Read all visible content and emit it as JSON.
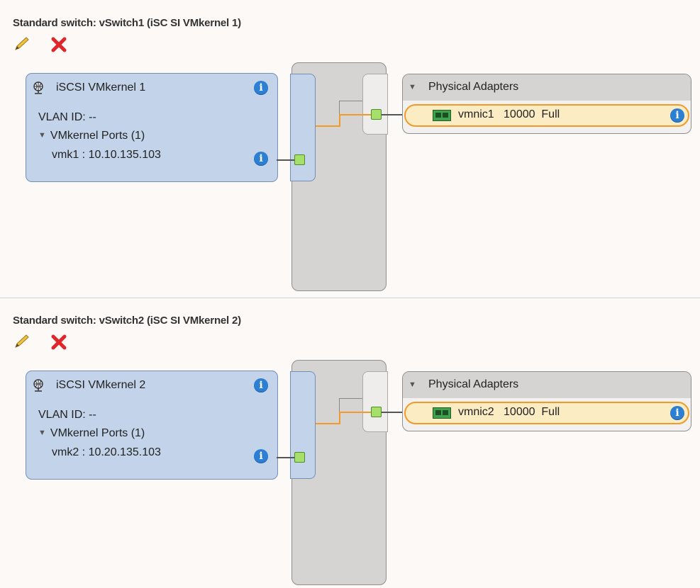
{
  "switches": [
    {
      "title": "Standard switch: vSwitch1 (iSC SI VMkernel 1)",
      "edit_label": "Edit",
      "delete_label": "Remove",
      "port_group": {
        "name": "iSCSI VMkernel 1",
        "vlan": "VLAN ID: --",
        "ports_label": "VMkernel Ports (1)",
        "vmk": "vmk1 : 10.10.135.103"
      },
      "physical_adapters": {
        "title": "Physical Adapters",
        "nics": [
          {
            "label": "vmnic1   10000  Full"
          }
        ]
      }
    },
    {
      "title": "Standard switch: vSwitch2 (iSC SI VMkernel 2)",
      "edit_label": "Edit",
      "delete_label": "Remove",
      "port_group": {
        "name": "iSCSI VMkernel 2",
        "vlan": "VLAN ID: --",
        "ports_label": "VMkernel Ports (1)",
        "vmk": "vmk2 : 10.20.135.103"
      },
      "physical_adapters": {
        "title": "Physical Adapters",
        "nics": [
          {
            "label": "vmnic2   10000  Full"
          }
        ]
      }
    }
  ],
  "icons": {
    "edit": "pencil-icon",
    "delete": "red-x-icon",
    "info": "info-icon",
    "portgroup": "network-globe-icon",
    "nic": "nic-card-icon",
    "info_glyph": "i",
    "collapse_glyph": "▼"
  },
  "colors": {
    "background": "#fcf9f7",
    "portgroup_fill": "#c3d4ea",
    "portgroup_border": "#7290b6",
    "info_blue": "#2d7fd4",
    "rail_grey": "#d6d4d2",
    "nic_fill": "#fbecc4",
    "nic_border": "#f09a2a",
    "link_orange": "#f09a2a",
    "port_green": "#a6e06b",
    "delete_red": "#e0262b"
  }
}
